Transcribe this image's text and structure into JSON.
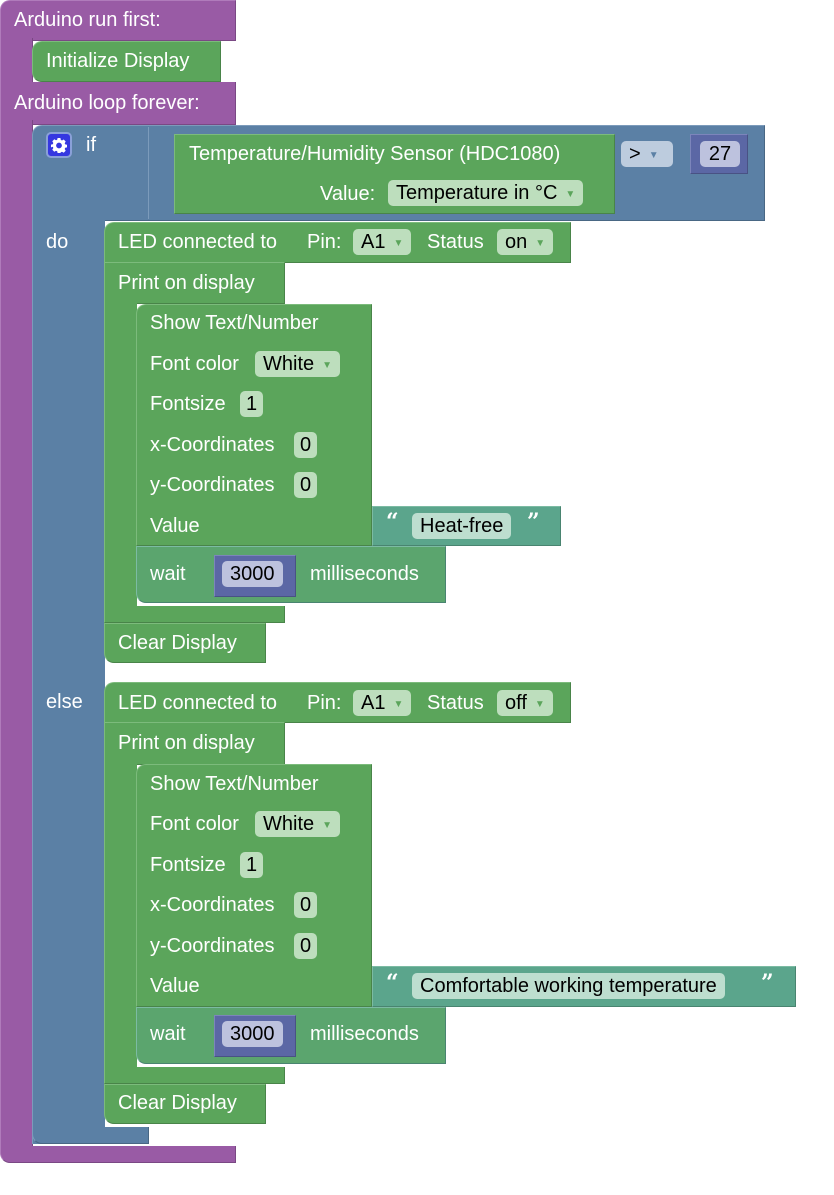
{
  "setup": {
    "header": "Arduino run first:",
    "init_block": "Initialize Display"
  },
  "loop": {
    "header": "Arduino loop forever:"
  },
  "if_block": {
    "if_label": "if",
    "do_label": "do",
    "else_label": "else",
    "gear_icon": "gear-icon",
    "condition": {
      "sensor_label": "Temperature/Humidity Sensor (HDC1080)",
      "value_label": "Value:",
      "value_option": "Temperature in °C",
      "operator": ">",
      "compare_value": "27"
    }
  },
  "do_branch": {
    "led": {
      "label": "LED connected to",
      "pin_label": "Pin:",
      "pin": "A1",
      "status_label": "Status",
      "status": "on"
    },
    "print_label": "Print on display",
    "show": {
      "title": "Show Text/Number",
      "font_color_label": "Font color",
      "font_color": "White",
      "fontsize_label": "Fontsize",
      "fontsize": "1",
      "x_label": "x-Coordinates",
      "x": "0",
      "y_label": "y-Coordinates",
      "y": "0",
      "value_label": "Value",
      "text": "Heat-free"
    },
    "wait": {
      "label": "wait",
      "ms": "3000",
      "unit": "milliseconds"
    },
    "clear": "Clear Display"
  },
  "else_branch": {
    "led": {
      "label": "LED connected to",
      "pin_label": "Pin:",
      "pin": "A1",
      "status_label": "Status",
      "status": "off"
    },
    "print_label": "Print on display",
    "show": {
      "title": "Show Text/Number",
      "font_color_label": "Font color",
      "font_color": "White",
      "fontsize_label": "Fontsize",
      "fontsize": "1",
      "x_label": "x-Coordinates",
      "x": "0",
      "y_label": "y-Coordinates",
      "y": "0",
      "value_label": "Value",
      "text": "Comfortable working temperature"
    },
    "wait": {
      "label": "wait",
      "ms": "3000",
      "unit": "milliseconds"
    },
    "clear": "Clear Display"
  },
  "quotes": {
    "open": "“",
    "close": "”"
  },
  "arrow": "▼",
  "colors": {
    "arduino_purple": "#995ba5",
    "logic_blue": "#5b80a5",
    "block_green": "#5ba55b",
    "text_teal": "#5ba58c",
    "math_indigo": "#5b67a5",
    "mutator_blue": "#3537e0"
  }
}
